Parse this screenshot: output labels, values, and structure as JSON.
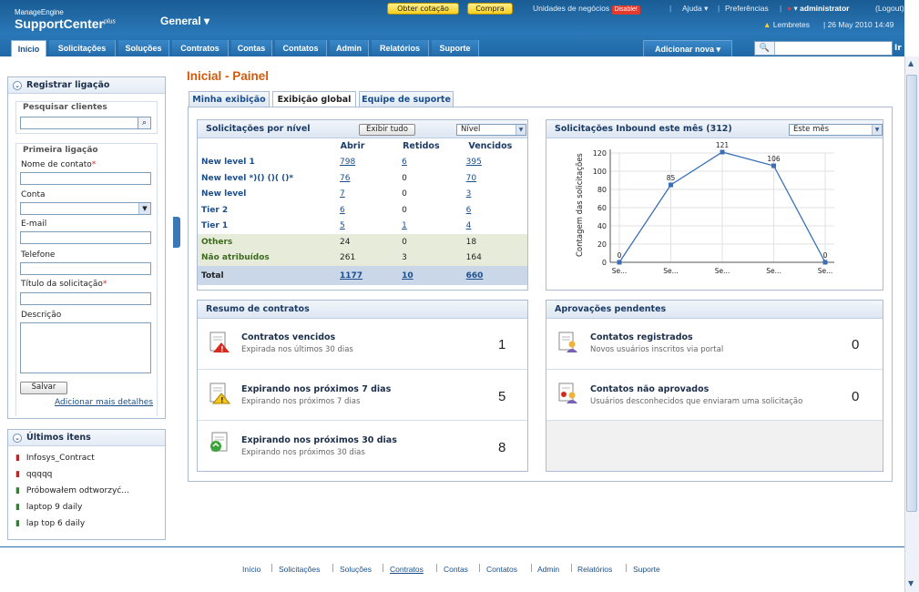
{
  "brand": {
    "vendor": "ManageEngine",
    "product": "SupportCenter",
    "suffix": "plus"
  },
  "header": {
    "general": "General",
    "btn_quote": "Obter cotação",
    "btn_buy": "Compra",
    "business_units": "Unidades de negócios",
    "disable": "Disable!",
    "help": "Ajuda",
    "prefs": "Preferências",
    "user": "administrator",
    "logout": "(Logout)",
    "reminders": "Lembretes",
    "datetime": "| 26 May 2010 14:49"
  },
  "tabs": [
    "Início",
    "Solicitações",
    "Soluções",
    "Contratos",
    "Contas",
    "Contatos",
    "Admin",
    "Relatórios",
    "Suporte"
  ],
  "add_new": "Adicionar nova",
  "search_go": "Ir",
  "left": {
    "register_title": "Registrar ligação",
    "search_clients": "Pesquisar clientes",
    "first_call": "Primeira ligação",
    "contact_name": "Nome de contato",
    "account": "Conta",
    "email": "E-mail",
    "phone": "Telefone",
    "req_title": "Título da solicitação",
    "description": "Descrição",
    "save": "Salvar",
    "more_details": "Adicionar mais detalhes",
    "recent_title": "Últimos itens",
    "recent": [
      "Infosys_Contract",
      "qqqqq",
      "Próbowałem odtworzyć...",
      "laptop 9 daily",
      "lap top 6 daily"
    ]
  },
  "page_title": "Inicial - Painel",
  "page_tabs": [
    "Minha exibição",
    "Exibição global",
    "Equipe de suporte"
  ],
  "level_widget": {
    "title": "Solicitações por nível",
    "show_all": "Exibir tudo",
    "select": "Nível",
    "headers": [
      "Abrir",
      "Retidos",
      "Vencidos"
    ],
    "rows": [
      {
        "name": "New level 1",
        "open": "798",
        "held": "6",
        "overdue": "395"
      },
      {
        "name": "New level *)() ()( ()*",
        "open": "76",
        "held": "0",
        "overdue": "70"
      },
      {
        "name": "New level",
        "open": "7",
        "held": "0",
        "overdue": "3"
      },
      {
        "name": "Tier 2",
        "open": "6",
        "held": "0",
        "overdue": "6"
      },
      {
        "name": "Tier 1",
        "open": "5",
        "held": "1",
        "overdue": "4"
      },
      {
        "name": "Others",
        "open": "24",
        "held": "0",
        "overdue": "18"
      },
      {
        "name": "Não atribuídos",
        "open": "261",
        "held": "3",
        "overdue": "164"
      }
    ],
    "total": {
      "name": "Total",
      "open": "1177",
      "held": "10",
      "overdue": "660"
    }
  },
  "inbound_widget": {
    "title": "Solicitações Inbound este mês (312)",
    "select": "Este mês"
  },
  "chart_data": {
    "type": "line",
    "categories": [
      "Se...",
      "Se...",
      "Se...",
      "Se...",
      "Se..."
    ],
    "values": [
      0,
      85,
      121,
      106,
      0
    ],
    "ylabel": "Contagem das solicitações",
    "xlabel": "",
    "ylim": [
      0,
      120
    ],
    "yticks": [
      0,
      20,
      40,
      60,
      80,
      100,
      120
    ],
    "grid": true,
    "color": "#3a6fb5"
  },
  "contracts_widget": {
    "title": "Resumo de contratos",
    "rows": [
      {
        "title": "Contratos vencidos",
        "sub": "Expirada nos últimos 30 dias",
        "count": "1"
      },
      {
        "title": "Expirando nos próximos 7 dias",
        "sub": "Expirando nos próximos 7 dias",
        "count": "5"
      },
      {
        "title": "Expirando nos próximos 30 dias",
        "sub": "Expirando nos próximos 30 dias",
        "count": "8"
      }
    ]
  },
  "approvals_widget": {
    "title": "Aprovações pendentes",
    "rows": [
      {
        "title": "Contatos registrados",
        "sub": "Novos usuários inscritos via portal",
        "count": "0"
      },
      {
        "title": "Contatos não aprovados",
        "sub": "Usuários desconhecidos que enviaram uma solicitação",
        "count": "0"
      }
    ]
  },
  "footer": [
    "Início",
    "Solicitações",
    "Soluções",
    "Contratos",
    "Contas",
    "Contatos",
    "Admin",
    "Relatórios",
    "Suporte"
  ]
}
